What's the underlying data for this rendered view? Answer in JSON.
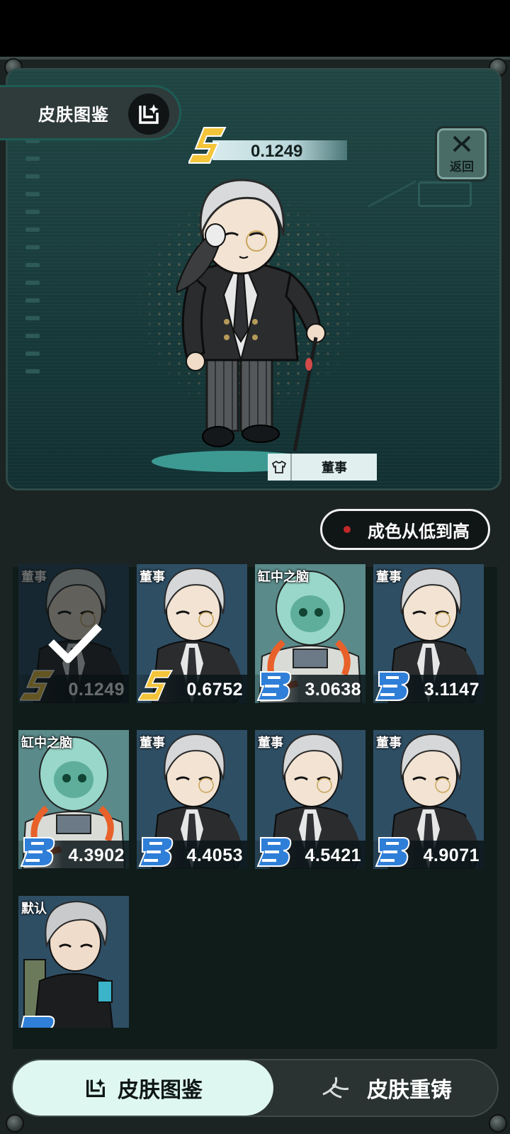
{
  "header": {
    "title": "皮肤图鉴",
    "back_label": "返回",
    "album_icon": "album-icon",
    "back_icon": "close-x-icon"
  },
  "currency": {
    "icon": "s-grade-icon",
    "value": "0.1249"
  },
  "current_skin": {
    "name": "董事",
    "icon": "shirt-icon"
  },
  "sort": {
    "label": "成色从低到高",
    "dot_color": "#c02828"
  },
  "skins": [
    {
      "name": "董事",
      "value": "0.1249",
      "grade": "S",
      "type": "director",
      "selected": true
    },
    {
      "name": "董事",
      "value": "0.6752",
      "grade": "S",
      "type": "director",
      "selected": false
    },
    {
      "name": "缸中之脑",
      "value": "3.0638",
      "grade": "B",
      "type": "brain",
      "selected": false
    },
    {
      "name": "董事",
      "value": "3.1147",
      "grade": "B",
      "type": "director",
      "selected": false
    },
    {
      "name": "缸中之脑",
      "value": "4.3902",
      "grade": "B",
      "type": "brain",
      "selected": false
    },
    {
      "name": "董事",
      "value": "4.4053",
      "grade": "B",
      "type": "director",
      "selected": false
    },
    {
      "name": "董事",
      "value": "4.5421",
      "grade": "B",
      "type": "director",
      "selected": false
    },
    {
      "name": "董事",
      "value": "4.9071",
      "grade": "B",
      "type": "director",
      "selected": false
    },
    {
      "name": "默认",
      "value": "",
      "grade": "B",
      "type": "default",
      "selected": false
    }
  ],
  "bottom_tabs": [
    {
      "label": "皮肤图鉴",
      "icon": "album-icon",
      "active": true
    },
    {
      "label": "皮肤重铸",
      "icon": "reforge-icon",
      "active": false
    }
  ],
  "colors": {
    "panel": "#1f4543",
    "accent_tab": "#dff7f1",
    "b_grade": "#2f7fd8",
    "s_grade": "#f2c13a"
  }
}
